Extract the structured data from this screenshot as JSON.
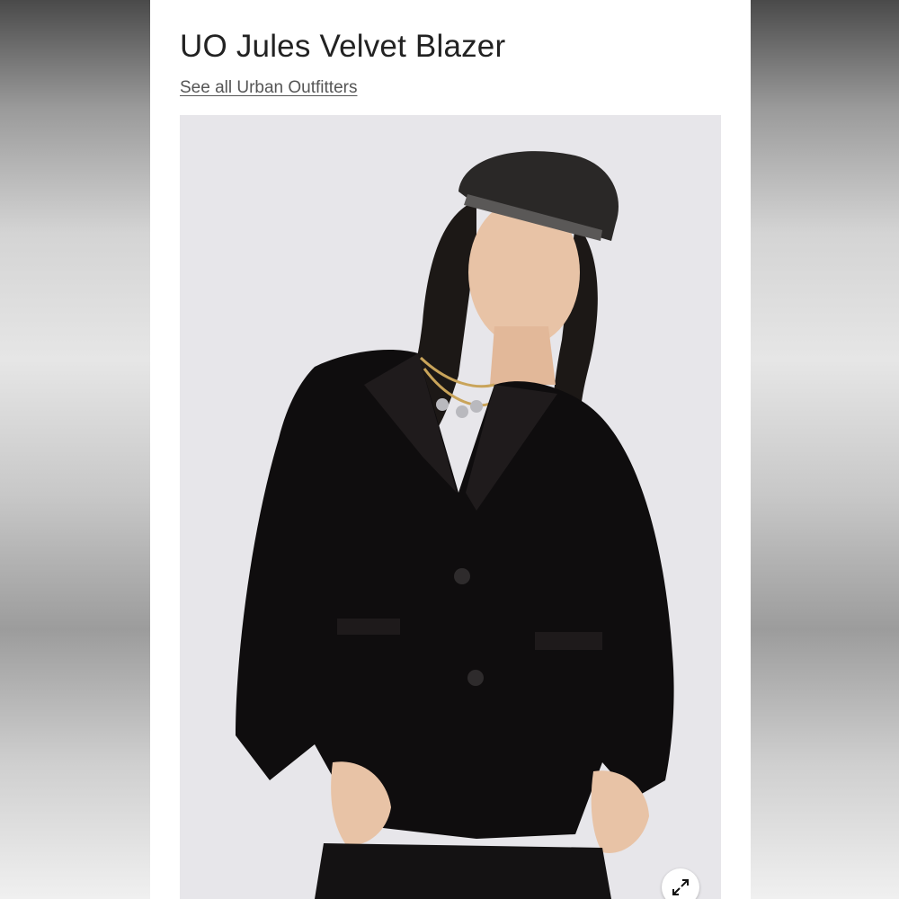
{
  "product": {
    "title": "UO Jules Velvet Blazer",
    "brand_link": "See all Urban Outfitters"
  },
  "image": {
    "subject": "model-wearing-black-velvet-blazer",
    "expand_icon": "expand-icon"
  },
  "colors": {
    "page_backdrop": "#8a8a8a",
    "card": "#ffffff",
    "title_text": "#222222",
    "link_text": "#555555",
    "photo_background": "#e7e6ea",
    "blazer": "#0f0d0e"
  }
}
